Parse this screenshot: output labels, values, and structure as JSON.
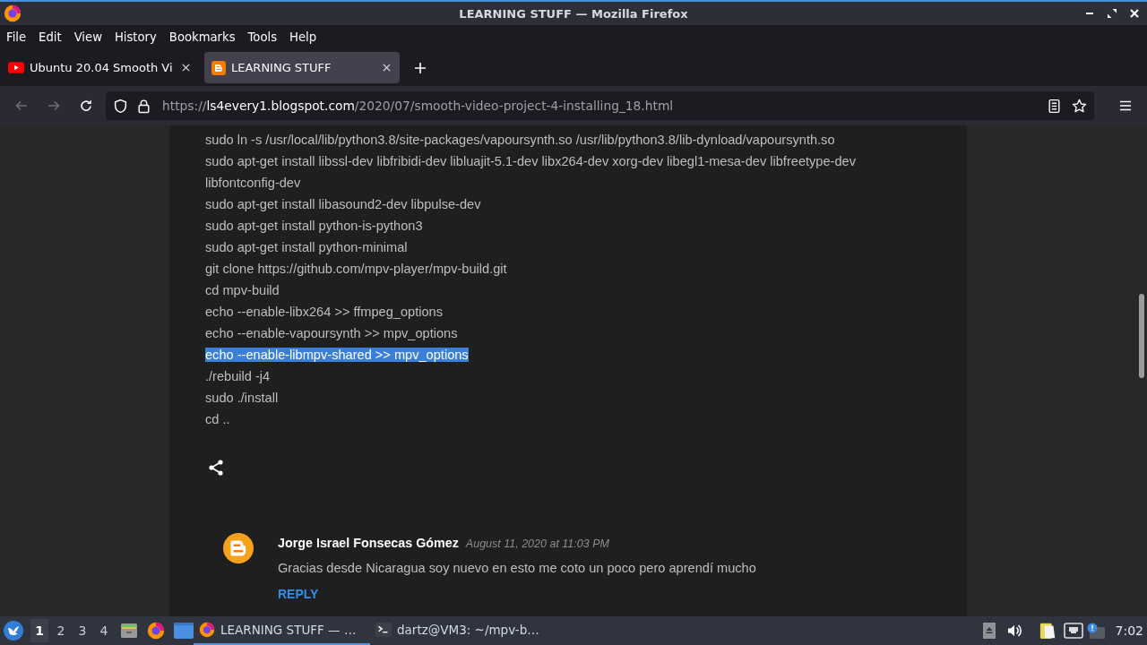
{
  "window": {
    "title": "LEARNING STUFF — Mozilla Firefox"
  },
  "menu": [
    "File",
    "Edit",
    "View",
    "History",
    "Bookmarks",
    "Tools",
    "Help"
  ],
  "tabs": [
    {
      "kind": "video",
      "title": "Ubuntu 20.04 Smooth Vi",
      "selected": false
    },
    {
      "kind": "blog",
      "title": "LEARNING STUFF",
      "selected": true
    }
  ],
  "toolbar": {
    "buttons": [
      {
        "kind": "back",
        "disabled": true
      },
      {
        "kind": "forward",
        "disabled": true
      },
      {
        "kind": "reload",
        "disabled": false
      }
    ],
    "url": {
      "scheme": "https://",
      "domain": "ls4every1.blogspot.com",
      "path": "/2020/07/smooth-video-project-4-installing_18.html"
    }
  },
  "post": {
    "lines": [
      {
        "text": "sudo ln -s /usr/local/lib/python3.8/site-packages/vapoursynth.so /usr/lib/python3.8/lib-dynload/vapoursynth.so",
        "selected": false
      },
      {
        "text": "sudo apt-get install libssl-dev libfribidi-dev libluajit-5.1-dev libx264-dev xorg-dev libegl1-mesa-dev libfreetype-dev libfontconfig-dev",
        "selected": false
      },
      {
        "text": "sudo apt-get install libasound2-dev libpulse-dev",
        "selected": false
      },
      {
        "text": "sudo apt-get install python-is-python3",
        "selected": false
      },
      {
        "text": "sudo apt-get install python-minimal",
        "selected": false
      },
      {
        "text": "git clone https://github.com/mpv-player/mpv-build.git",
        "selected": false
      },
      {
        "text": "cd mpv-build",
        "selected": false
      },
      {
        "text": "echo --enable-libx264 >> ffmpeg_options",
        "selected": false
      },
      {
        "text": "echo --enable-vapoursynth >> mpv_options",
        "selected": false
      },
      {
        "text": "echo --enable-libmpv-shared >> mpv_options",
        "selected": true
      },
      {
        "text": "./rebuild -j4",
        "selected": false
      },
      {
        "text": "sudo ./install",
        "selected": false
      },
      {
        "text": "cd ..",
        "selected": false
      }
    ]
  },
  "comments": [
    {
      "author": "Jorge Israel Fonsecas Gómez",
      "date": "August 11, 2020 at 11:03 PM",
      "text": "Gracias desde Nicaragua soy nuevo en esto me coto un poco pero aprendí mucho",
      "reply": "REPLY"
    }
  ],
  "taskbar": {
    "workspaces": [
      {
        "label": "1",
        "selected": true
      },
      {
        "label": "2",
        "selected": false
      },
      {
        "label": "3",
        "selected": false
      },
      {
        "label": "4",
        "selected": false
      }
    ],
    "tasks": [
      {
        "kind": "browser",
        "title": "LEARNING STUFF — …",
        "selected": true
      },
      {
        "kind": "terminal",
        "title": "dartz@VM3: ~/mpv-b…",
        "selected": false
      }
    ],
    "clock": "7:02"
  }
}
